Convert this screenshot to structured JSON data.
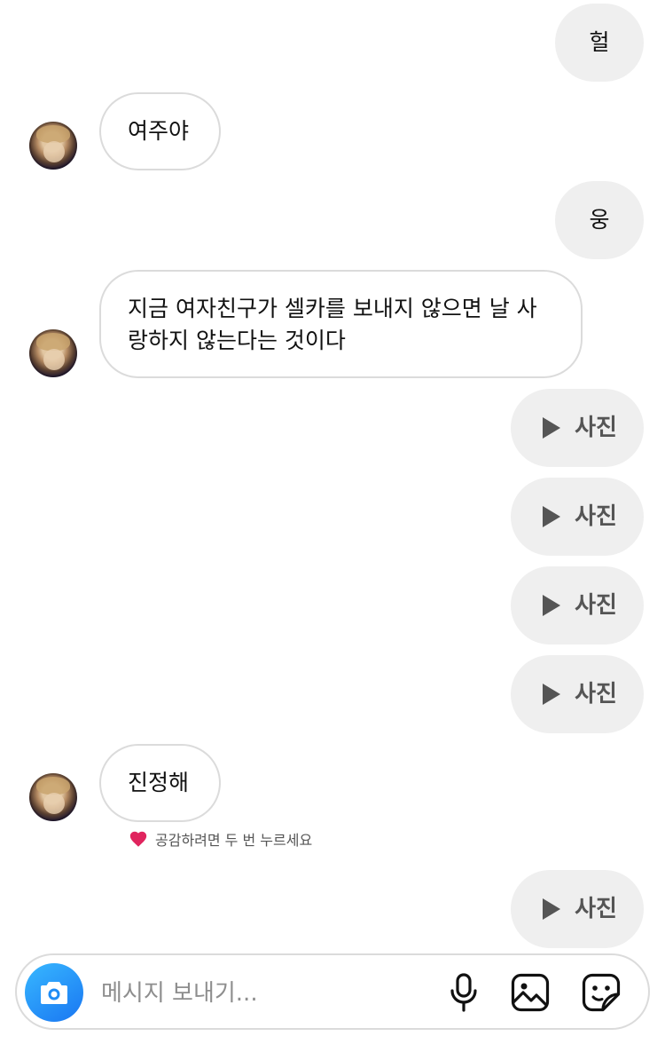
{
  "messages": {
    "m1": "헐",
    "m2": "여주야",
    "m3": "웅",
    "m4": "지금 여자친구가 셀카를 보내지 않으면 날 사랑하지 않는다는 것이다",
    "photo_label": "사진",
    "m9": "진정해"
  },
  "reaction": {
    "hint": "공감하려면 두 번 누르세요"
  },
  "composer": {
    "placeholder": "메시지 보내기..."
  },
  "icons": {
    "camera": "camera-icon",
    "mic": "microphone-icon",
    "gallery": "image-icon",
    "sticker": "sticker-icon",
    "play": "play-icon",
    "heart": "heart-icon"
  },
  "colors": {
    "sent_bubble": "#efefef",
    "recv_border": "#dbdbdb",
    "camera_blue": "#1976f2",
    "heart_red": "#e0245e"
  }
}
